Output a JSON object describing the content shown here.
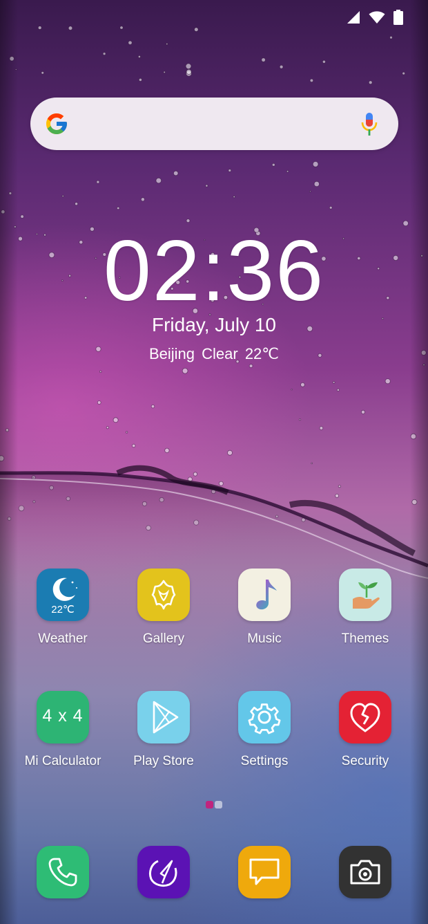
{
  "status_bar": {
    "icons": [
      "cell-signal-icon",
      "wifi-icon",
      "battery-icon"
    ]
  },
  "search": {
    "logo": "google-g-icon",
    "voice": "microphone-icon"
  },
  "clock": {
    "hours": "02",
    "separator": ":",
    "minutes": "36",
    "date": "Friday, July 10",
    "weather": "Beijing  Clear  22℃"
  },
  "apps": [
    {
      "label": "Weather",
      "icon": "weather-moon-icon",
      "badge_text": "22℃",
      "color": "#1a7fb3"
    },
    {
      "label": "Gallery",
      "icon": "gallery-flower-icon",
      "color": "#e3c41d"
    },
    {
      "label": "Music",
      "icon": "music-note-icon",
      "color": "#f4f1e3"
    },
    {
      "label": "Themes",
      "icon": "themes-plant-hand-icon",
      "color": "#c9ebe8"
    },
    {
      "label": "Mi Calculator",
      "icon": "calculator-icon",
      "badge_text": "4 x 4",
      "color": "#2fb574"
    },
    {
      "label": "Play Store",
      "icon": "play-store-icon",
      "color": "#7ad2ec"
    },
    {
      "label": "Settings",
      "icon": "settings-gear-icon",
      "color": "#64c8ea"
    },
    {
      "label": "Security",
      "icon": "security-heart-icon",
      "color": "#e52234"
    }
  ],
  "dock": [
    {
      "name": "phone",
      "icon": "phone-icon",
      "color": "#2fbd76"
    },
    {
      "name": "browser",
      "icon": "browser-compass-icon",
      "color": "#5b13b5"
    },
    {
      "name": "messages",
      "icon": "message-bubble-icon",
      "color": "#f0a90d"
    },
    {
      "name": "camera",
      "icon": "camera-icon",
      "color": "#333333"
    }
  ],
  "page_indicator": {
    "pages": 2,
    "current": 1,
    "active_color": "#c0257e"
  }
}
